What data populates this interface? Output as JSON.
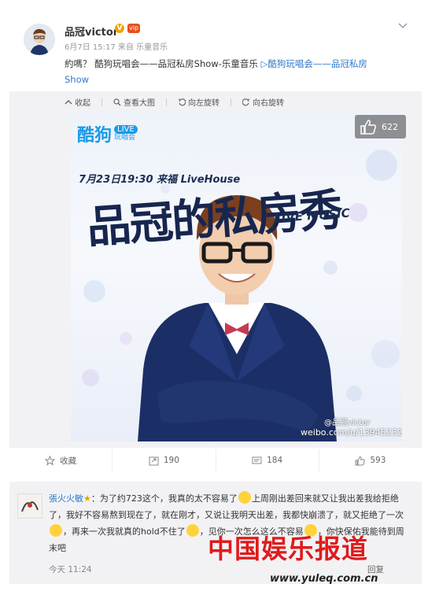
{
  "post": {
    "author": "品冠victor",
    "verified_mark": "V",
    "member_badge": "vip",
    "meta": "6月7日 15:17 来自 乐童音乐",
    "text_prefix": "約嗎？ 酷狗玩唱会——品冠私房Show-乐童音乐 ",
    "link_text": "▷酷狗玩唱会——品冠私房",
    "link_text_wrap": "Show"
  },
  "image_toolbar": {
    "collapse": "收起",
    "view_large": "查看大图",
    "rotate_left": "向左旋转",
    "rotate_right": "向右旋转"
  },
  "poster": {
    "logo": "酷狗",
    "logo_live_1": "LIVE",
    "logo_live_2": "玩唱会",
    "date_venue": "7月23日19:30 来福 LiveHouse",
    "title": "品冠的私房秀",
    "subtitle": "LIVE MUSIC",
    "like_count": "622",
    "watermark_handle": "@品冠victor",
    "watermark_url": "weibo.com/u/1394523250"
  },
  "actions": {
    "favorite": "收藏",
    "repost": "190",
    "comment": "184",
    "like": "593"
  },
  "comment": {
    "name": "張火火敏",
    "body_1": "：为了约723这个，我真的太不容易了",
    "body_2": "上周刚出差回来就又让我出差我给拒绝了，我好不容易熬到现在了，就在刚才，又说让我明天出差，我都快崩溃了",
    "body_3": "，就又拒绝了一次",
    "body_4": "，再来一次我就真的hold不住了",
    "body_5": "，见你一次怎么这么不容易",
    "body_6": "，你快保佑我能待到周末吧",
    "time": "今天 11:24",
    "reply": "回复"
  },
  "watermark": {
    "brand": "中国娱乐报道",
    "url": "www.yuleq.com.cn"
  },
  "colors": {
    "link": "#2e78c9",
    "watermark_red": "#e01b1b",
    "panel_bg": "#f2f2f5"
  },
  "icons": [
    "chevron-down-icon",
    "collapse-icon",
    "zoom-icon",
    "rotate-left-icon",
    "rotate-right-icon",
    "thumb-up-icon",
    "star-icon",
    "repost-icon",
    "comment-icon",
    "like-icon"
  ]
}
